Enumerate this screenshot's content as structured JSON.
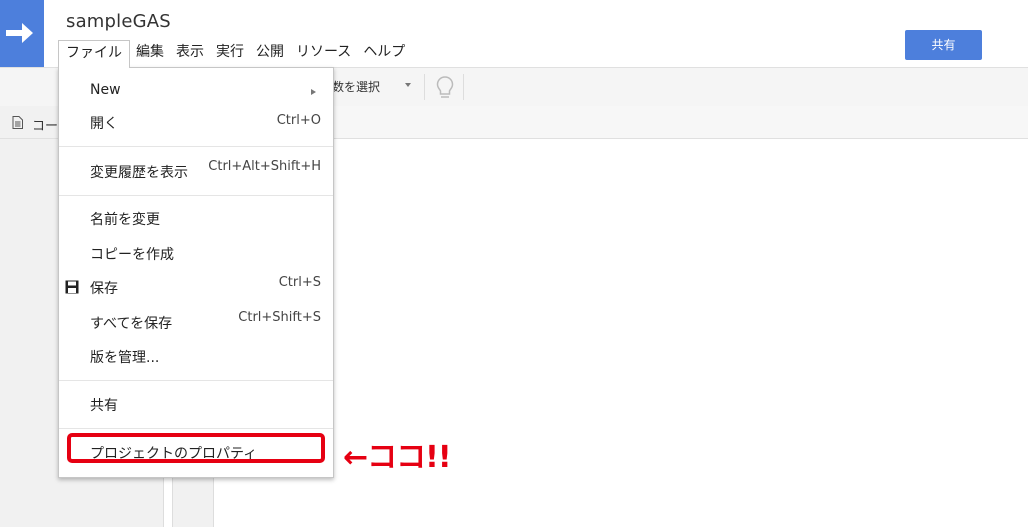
{
  "header": {
    "project_title": "sampleGAS",
    "share_label": "共有",
    "logo_icon": "arrow-right-icon",
    "accent_color": "#4d7fdc"
  },
  "menubar": {
    "items": [
      {
        "label": "ファイル",
        "active": true
      },
      {
        "label": "編集"
      },
      {
        "label": "表示"
      },
      {
        "label": "実行"
      },
      {
        "label": "公開"
      },
      {
        "label": "リソース"
      },
      {
        "label": "ヘルプ"
      }
    ]
  },
  "toolbar": {
    "function_select_label": "数を選択",
    "bulb_icon": "lightbulb-icon"
  },
  "sidebar": {
    "file_tab_label": "コー"
  },
  "file_menu": {
    "items": [
      {
        "label": "New",
        "shortcut": "",
        "submenu": true
      },
      {
        "label": "開く",
        "shortcut": "Ctrl+O"
      },
      {
        "label": "変更履歴を表示",
        "shortcut": "Ctrl+Alt+Shift+H"
      },
      {
        "label": "名前を変更",
        "shortcut": ""
      },
      {
        "label": "コピーを作成",
        "shortcut": ""
      },
      {
        "label": "保存",
        "shortcut": "Ctrl+S",
        "icon": "save-icon"
      },
      {
        "label": "すべてを保存",
        "shortcut": "Ctrl+Shift+S"
      },
      {
        "label": "版を管理...",
        "shortcut": ""
      },
      {
        "label": "共有",
        "shortcut": ""
      },
      {
        "label": "プロジェクトのプロパティ",
        "shortcut": ""
      }
    ]
  },
  "annotation": {
    "text": "←ココ!!",
    "color": "#e60012"
  }
}
